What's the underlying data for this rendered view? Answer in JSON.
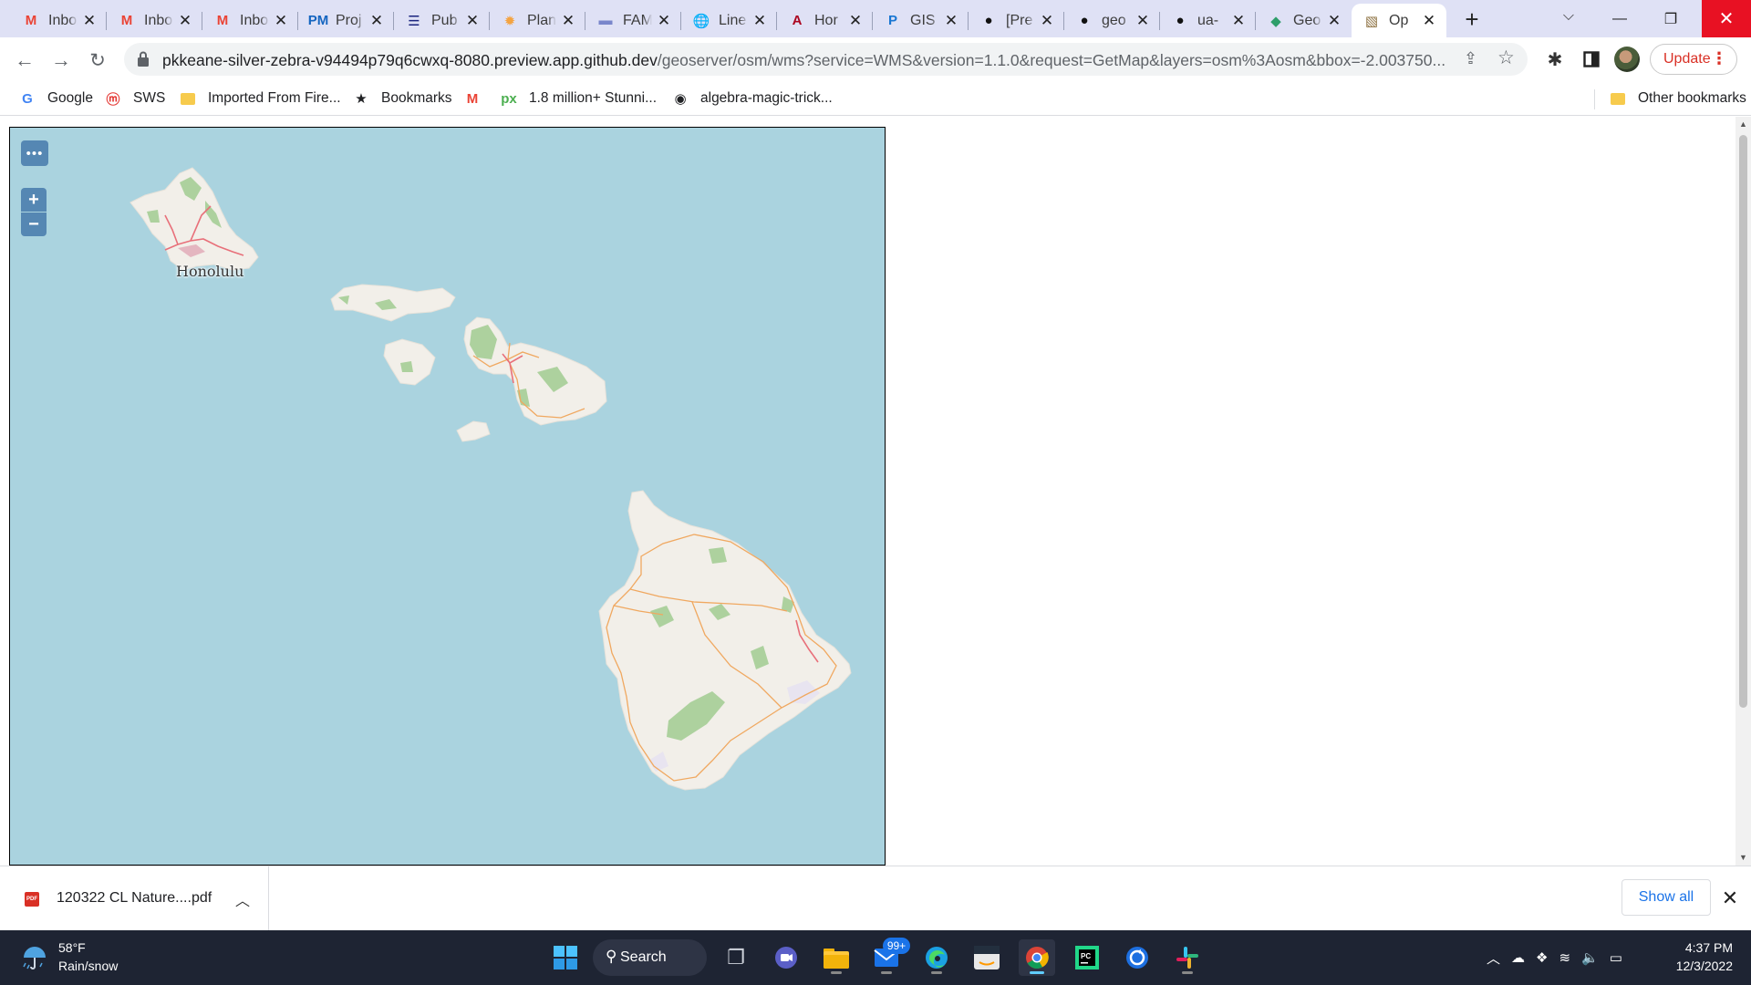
{
  "tabs": [
    {
      "icon": "gmail-icon",
      "glyph": "M",
      "color": "#ea4335",
      "title": "Inbox"
    },
    {
      "icon": "gmail-icon",
      "glyph": "M",
      "color": "#ea4335",
      "title": "Inbox"
    },
    {
      "icon": "gmail-icon",
      "glyph": "M",
      "color": "#ea4335",
      "title": "Inbox"
    },
    {
      "icon": "pm-icon",
      "glyph": "PM",
      "color": "#1565c0",
      "title": "Proj"
    },
    {
      "icon": "list-icon",
      "glyph": "☰",
      "color": "#1a237e",
      "title": "Pub"
    },
    {
      "icon": "sun-icon",
      "glyph": "✹",
      "color": "#f4a340",
      "title": "Plan"
    },
    {
      "icon": "fam-icon",
      "glyph": "▬",
      "color": "#7986cb",
      "title": "FAM"
    },
    {
      "icon": "globe-icon",
      "glyph": "🌐",
      "color": "#555555",
      "title": "Line"
    },
    {
      "icon": "arizona-icon",
      "glyph": "A",
      "color": "#ab0520",
      "title": "Hor"
    },
    {
      "icon": "p-icon",
      "glyph": "P",
      "color": "#1976d2",
      "title": "GIS"
    },
    {
      "icon": "github-icon",
      "glyph": "●",
      "color": "#111111",
      "title": "[Pre"
    },
    {
      "icon": "github-icon",
      "glyph": "●",
      "color": "#111111",
      "title": "geo"
    },
    {
      "icon": "github-icon",
      "glyph": "●",
      "color": "#111111",
      "title": "ua-"
    },
    {
      "icon": "geoserver-icon",
      "glyph": "◆",
      "color": "#2e9e6a",
      "title": "Geo"
    },
    {
      "icon": "openlayers-icon",
      "glyph": "▧",
      "color": "#8a6d3b",
      "title": "Op",
      "active": true
    }
  ],
  "toolbar": {
    "url_host": "pkkeane-silver-zebra-v94494p79q6cwxq-8080.preview.app.github.dev",
    "url_path": "/geoserver/osm/wms?service=WMS&version=1.1.0&request=GetMap&layers=osm%3Aosm&bbox=-2.003750...",
    "update_label": "Update"
  },
  "bookmarks": [
    {
      "icon": "google-icon",
      "glyph": "G",
      "color": "#4285f4",
      "label": "Google"
    },
    {
      "icon": "sws-icon",
      "glyph": "ⓜ",
      "color": "#e53935",
      "label": "SWS"
    },
    {
      "icon": "folder-icon",
      "glyph": "",
      "color": "#f7cb4d",
      "label": "Imported From Fire..."
    },
    {
      "icon": "star-icon",
      "glyph": "★",
      "color": "#202124",
      "label": "Bookmarks"
    },
    {
      "icon": "gmail-icon",
      "glyph": "M",
      "color": "#ea4335",
      "label": ""
    },
    {
      "icon": "px-icon",
      "glyph": "px",
      "color": "#4caf50",
      "label": "1.8 million+ Stunni..."
    },
    {
      "icon": "globe-icon",
      "glyph": "◉",
      "color": "#202124",
      "label": "algebra-magic-trick..."
    }
  ],
  "other_bookmarks": "Other bookmarks",
  "map": {
    "city_label": "Honolulu",
    "zoom_in": "+",
    "zoom_out": "−",
    "menu": "•••",
    "colors": {
      "water": "#aad3df",
      "land": "#f2efe9",
      "park": "#add19e",
      "road": "#f0a860",
      "highway": "#e8707a"
    }
  },
  "downloads": {
    "file_name": "120322 CL Nature....pdf",
    "show_all": "Show all"
  },
  "taskbar": {
    "temperature": "58°F",
    "weather": "Rain/snow",
    "search_label": "Search",
    "mail_badge": "99+",
    "time": "4:37 PM",
    "date": "12/3/2022"
  }
}
